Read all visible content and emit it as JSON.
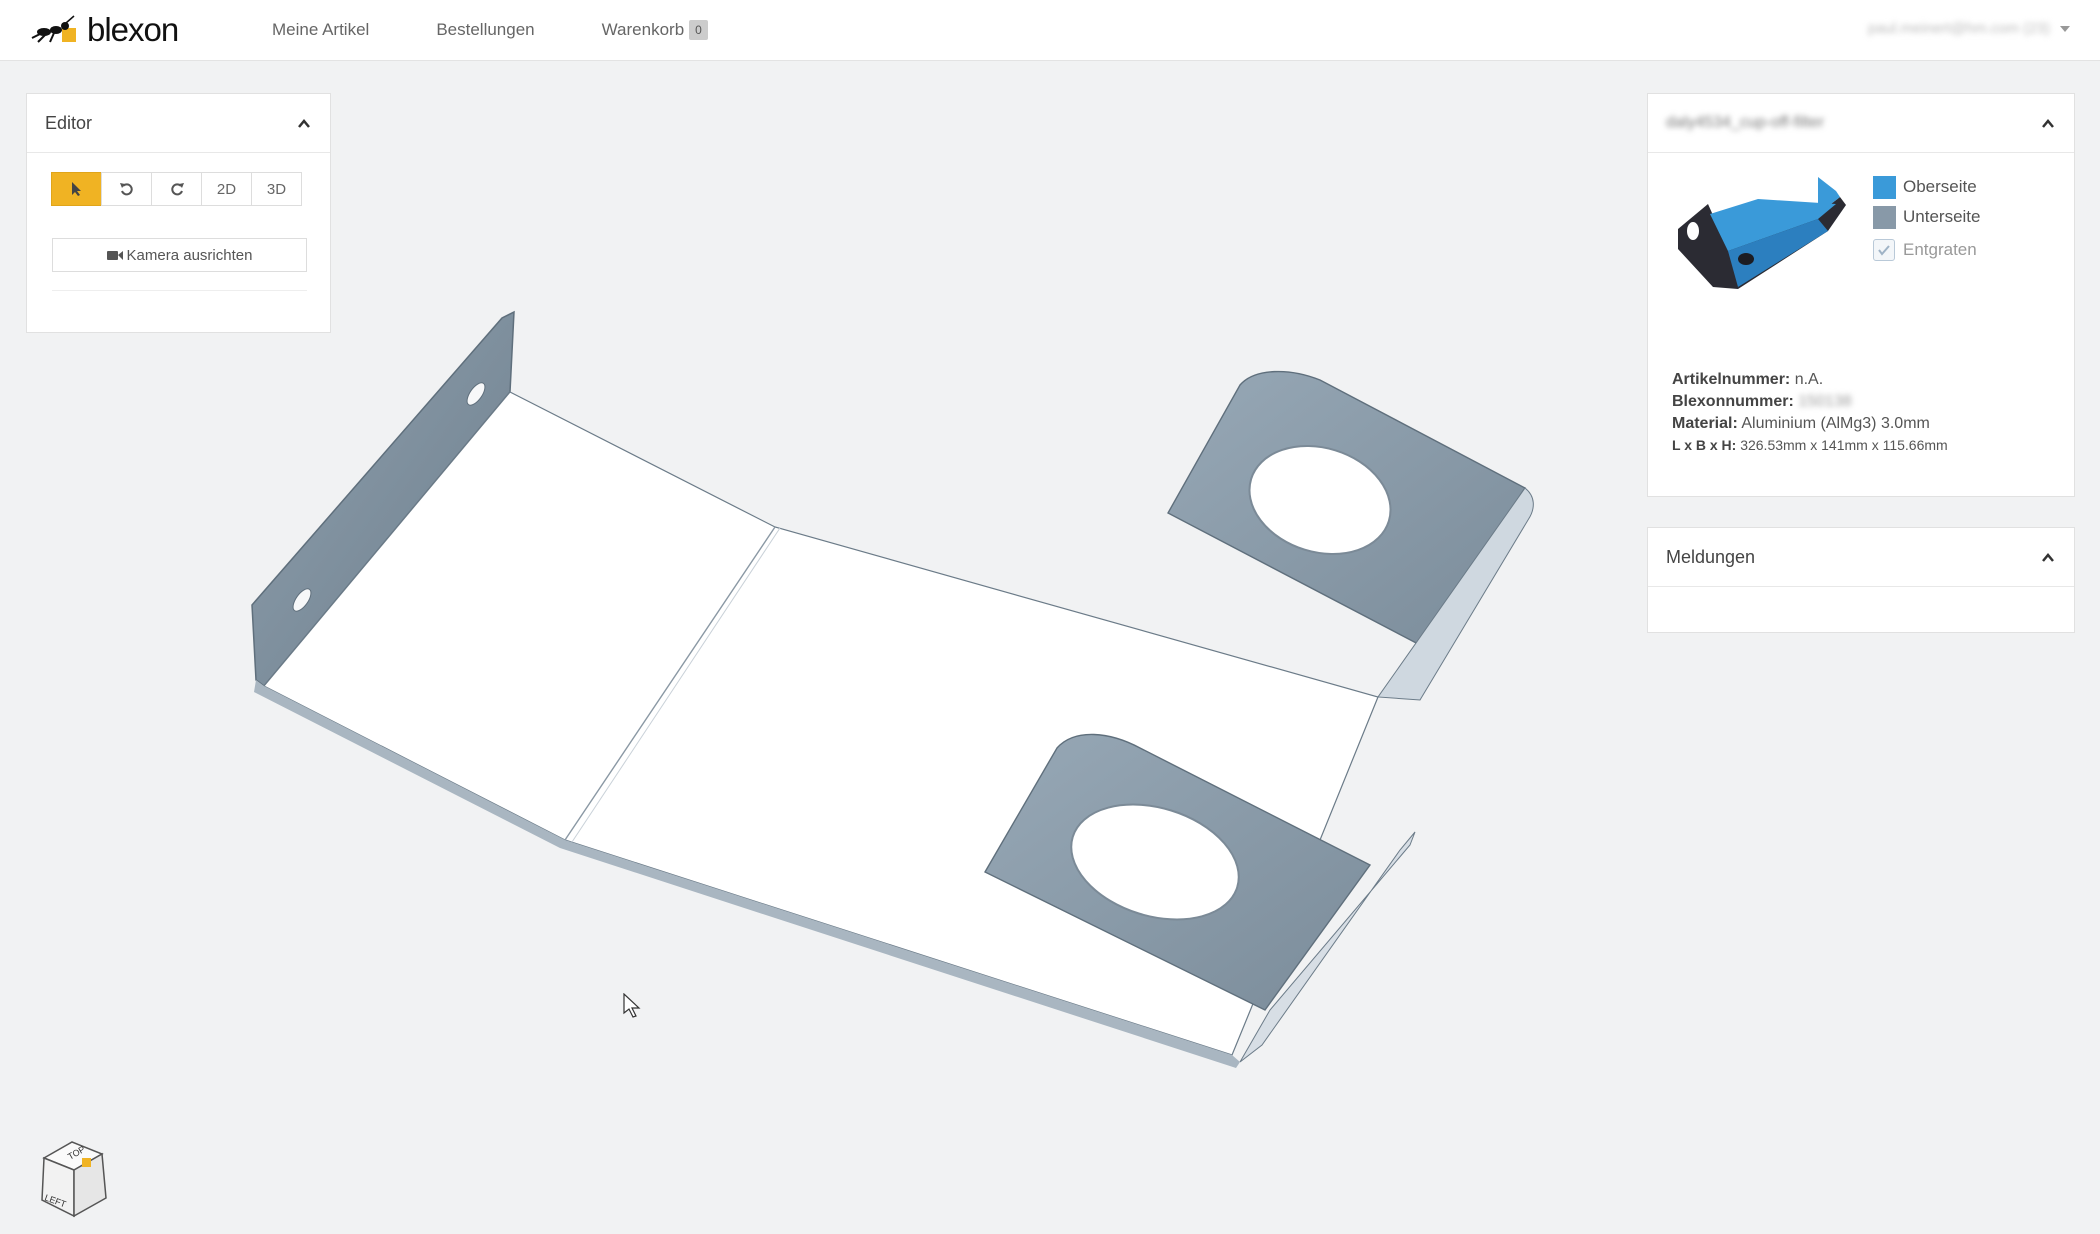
{
  "app": {
    "brand": "blexon",
    "nav": [
      {
        "label": "Meine Artikel"
      },
      {
        "label": "Bestellungen"
      },
      {
        "label": "Warenkorb"
      }
    ],
    "cart_count": "0",
    "user_email": "paul.meinert@hm.com (23)"
  },
  "editor": {
    "title": "Editor",
    "tools": {
      "mode_2d": "2D",
      "mode_3d": "3D"
    },
    "camera_button": "Kamera ausrichten"
  },
  "part": {
    "name": "daly4534_cup-off-filter",
    "legend": [
      {
        "label": "Oberseite",
        "color": "#3a9ad9"
      },
      {
        "label": "Unterseite",
        "color": "#8899a8"
      },
      {
        "label": "Entgraten"
      }
    ],
    "props": {
      "artikelnummer_label": "Artikelnummer:",
      "artikelnummer_value": "n.A.",
      "blexonnummer_label": "Blexonnummer:",
      "blexonnummer_value": "150138",
      "material_label": "Material:",
      "material_value": "Aluminium (AlMg3) 3.0mm",
      "dims_label": "L x B x H:",
      "dims_value": "326.53mm x 141mm x 115.66mm"
    }
  },
  "messages": {
    "title": "Meldungen"
  },
  "viewcube": {
    "top": "TOP",
    "left": "LEFT"
  }
}
